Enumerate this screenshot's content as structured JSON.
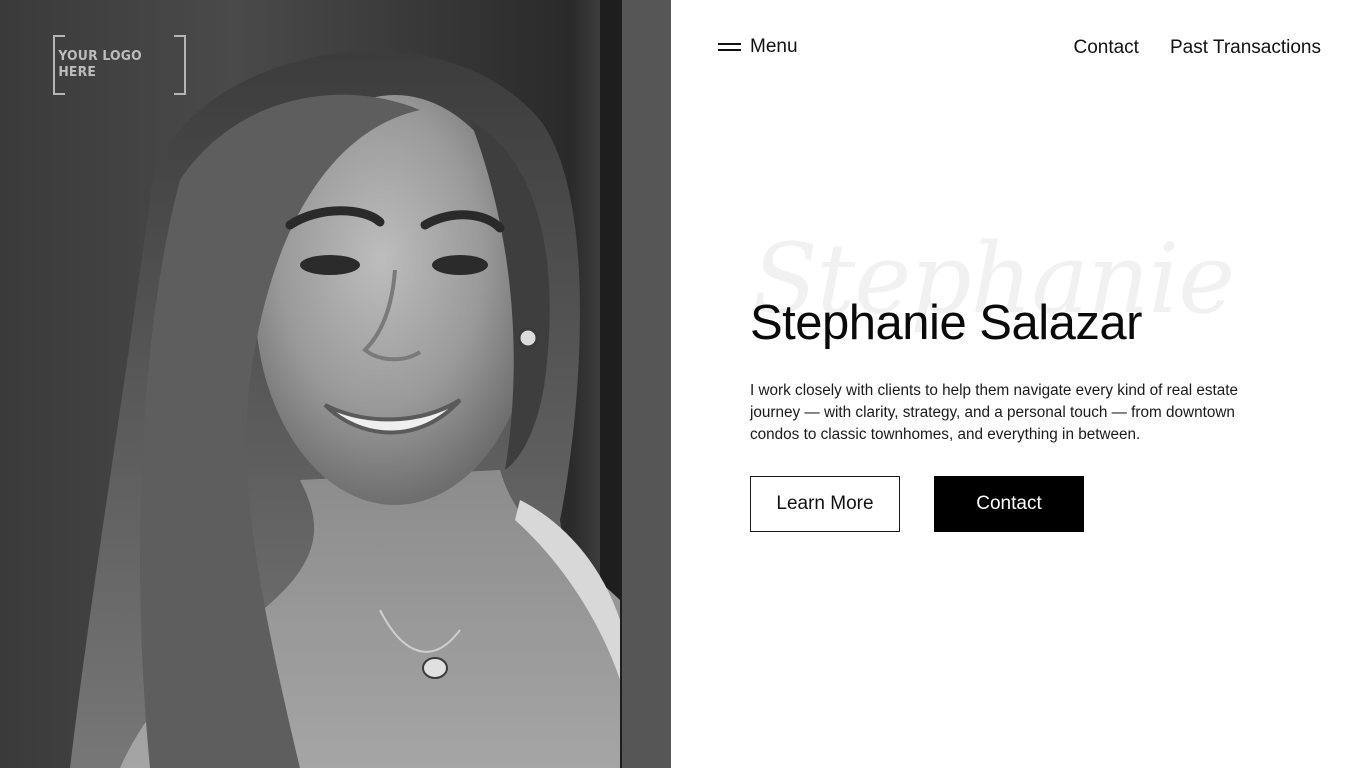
{
  "logo": {
    "text": "YOUR LOGO HERE"
  },
  "header": {
    "menu_label": "Menu",
    "nav_links": [
      {
        "label": "Contact"
      },
      {
        "label": "Past Transactions"
      }
    ]
  },
  "hero": {
    "script_name": "Stephanie",
    "title": "Stephanie Salazar",
    "description": "I work closely with clients to help them navigate every kind of real estate journey — with clarity, strategy, and a personal touch — from downtown condos to classic townhomes, and everything in between.",
    "buttons": {
      "learn_more": "Learn More",
      "contact": "Contact"
    }
  },
  "colors": {
    "text": "#111111",
    "background": "#ffffff",
    "button_primary_bg": "#000000",
    "button_primary_text": "#ffffff"
  },
  "icons": {
    "menu": "hamburger-menu-icon"
  }
}
